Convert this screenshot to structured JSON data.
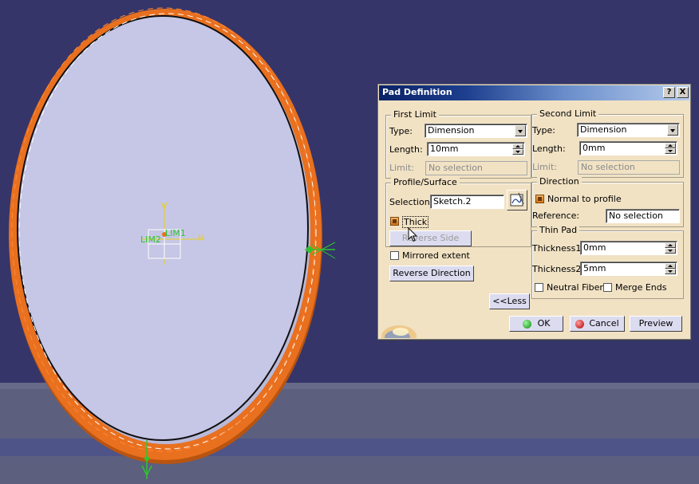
{
  "dialog": {
    "title": "Pad Definition",
    "help_label": "?",
    "close_label": "X",
    "first_limit": {
      "legend": "First Limit",
      "type_label": "Type:",
      "type_value": "Dimension",
      "length_label": "Length:",
      "length_value": "10mm",
      "limit_label": "Limit:",
      "limit_value": "No selection"
    },
    "second_limit": {
      "legend": "Second Limit",
      "type_label": "Type:",
      "type_value": "Dimension",
      "length_label": "Length:",
      "length_value": "0mm",
      "limit_label": "Limit:",
      "limit_value": "No selection"
    },
    "profile": {
      "legend": "Profile/Surface",
      "selection_label": "Selection:",
      "selection_value": "Sketch.2",
      "thick_label": "Thick",
      "thick_checked": true,
      "reverse_side_label": "Reverse Side"
    },
    "direction": {
      "legend": "Direction",
      "normal_label": "Normal to profile",
      "normal_checked": true,
      "reference_label": "Reference:",
      "reference_value": "No selection"
    },
    "thin_pad": {
      "legend": "Thin Pad",
      "thickness1_label": "Thickness1:",
      "thickness1_value": "0mm",
      "thickness2_label": "Thickness2:",
      "thickness2_value": "5mm",
      "neutral_fiber_label": "Neutral Fiber",
      "neutral_fiber_checked": false,
      "merge_ends_label": "Merge Ends",
      "merge_ends_checked": false
    },
    "mirrored_extent_label": "Mirrored extent",
    "mirrored_extent_checked": false,
    "reverse_direction_label": "Reverse Direction",
    "less_label": "<<Less",
    "ok_label": "OK",
    "cancel_label": "Cancel",
    "preview_label": "Preview"
  },
  "viewport": {
    "sketch_labels": {
      "lim1": "LIM1",
      "lim2": "LIM2",
      "h_axis": "H",
      "v_axis": "V"
    },
    "colors": {
      "background": "#35356a",
      "floor": "#5c5f7e",
      "pad_face": "#c2c2e2",
      "pad_edge": "#e8701f",
      "sketch": "#2fc42f",
      "axis": "#e8d020"
    }
  },
  "icons": {
    "sketcher": "sketcher-icon",
    "ok": "green-dot-icon",
    "cancel": "red-dot-icon",
    "cursor": "mouse-pointer-icon",
    "logo": "catia-logo-icon"
  }
}
